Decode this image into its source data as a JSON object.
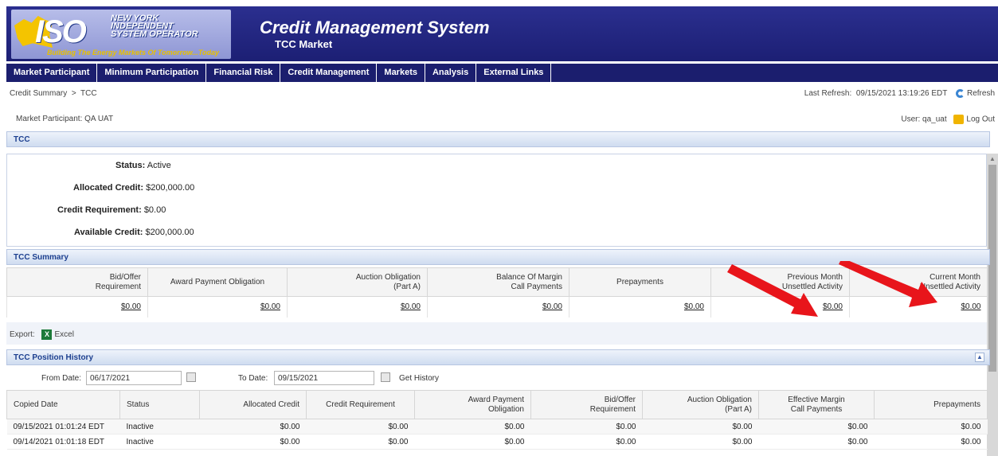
{
  "header": {
    "logo_iso": "ISO",
    "logo_lines": [
      "NEW YORK",
      "INDEPENDENT",
      "SYSTEM OPERATOR"
    ],
    "logo_tagline": "Building The Energy Markets Of Tomorrow...Today",
    "app_title": "Credit Management System",
    "app_subtitle": "TCC Market"
  },
  "nav": [
    "Market Participant",
    "Minimum Participation",
    "Financial Risk",
    "Credit Management",
    "Markets",
    "Analysis",
    "External Links"
  ],
  "breadcrumb": {
    "root": "Credit Summary",
    "separator": ">",
    "current": "TCC"
  },
  "refresh": {
    "label": "Last Refresh:",
    "time": "09/15/2021 13:19:26 EDT",
    "button": "Refresh"
  },
  "participant": {
    "label": "Market Participant:",
    "value": "QA UAT"
  },
  "user": {
    "label": "User:",
    "value": "qa_uat",
    "logout": "Log Out"
  },
  "tcc_section": "TCC",
  "status": {
    "status_label": "Status:",
    "status_value": "Active",
    "allocated_label": "Allocated Credit:",
    "allocated_value": "$200,000.00",
    "requirement_label": "Credit Requirement:",
    "requirement_value": "$0.00",
    "available_label": "Available Credit:",
    "available_value": "$200,000.00"
  },
  "summary": {
    "title": "TCC Summary",
    "headers": [
      "Bid/Offer\nRequirement",
      "Award Payment Obligation",
      "Auction Obligation\n(Part A)",
      "Balance Of Margin\nCall Payments",
      "Prepayments",
      "Previous Month\nUnsettled Activity",
      "Current Month\nUnsettled Activity"
    ],
    "values": [
      "$0.00",
      "$0.00",
      "$0.00",
      "$0.00",
      "$0.00",
      "$0.00",
      "$0.00"
    ]
  },
  "export": {
    "label": "Export:",
    "excel": "Excel"
  },
  "history": {
    "title": "TCC Position History",
    "from_label": "From Date:",
    "from_value": "06/17/2021",
    "to_label": "To Date:",
    "to_value": "09/15/2021",
    "get_history": "Get History",
    "headers": [
      "Copied Date",
      "Status",
      "Allocated Credit",
      "Credit Requirement",
      "Award Payment\nObligation",
      "Bid/Offer\nRequirement",
      "Auction Obligation\n(Part A)",
      "Effective Margin\nCall Payments",
      "Prepayments"
    ],
    "rows": [
      [
        "09/15/2021 01:01:24 EDT",
        "Inactive",
        "$0.00",
        "$0.00",
        "$0.00",
        "$0.00",
        "$0.00",
        "$0.00",
        "$0.00"
      ],
      [
        "09/14/2021 01:01:18 EDT",
        "Inactive",
        "$0.00",
        "$0.00",
        "$0.00",
        "$0.00",
        "$0.00",
        "$0.00",
        "$0.00"
      ]
    ]
  },
  "colors": {
    "nav_bg": "#1b1e6e",
    "banner": "#2b2f8f",
    "section_text": "#1c3f8f",
    "arrow": "#e8151b"
  },
  "icons": [
    "refresh-icon",
    "lock-icon",
    "excel-icon",
    "calendar-icon",
    "collapse-icon"
  ]
}
